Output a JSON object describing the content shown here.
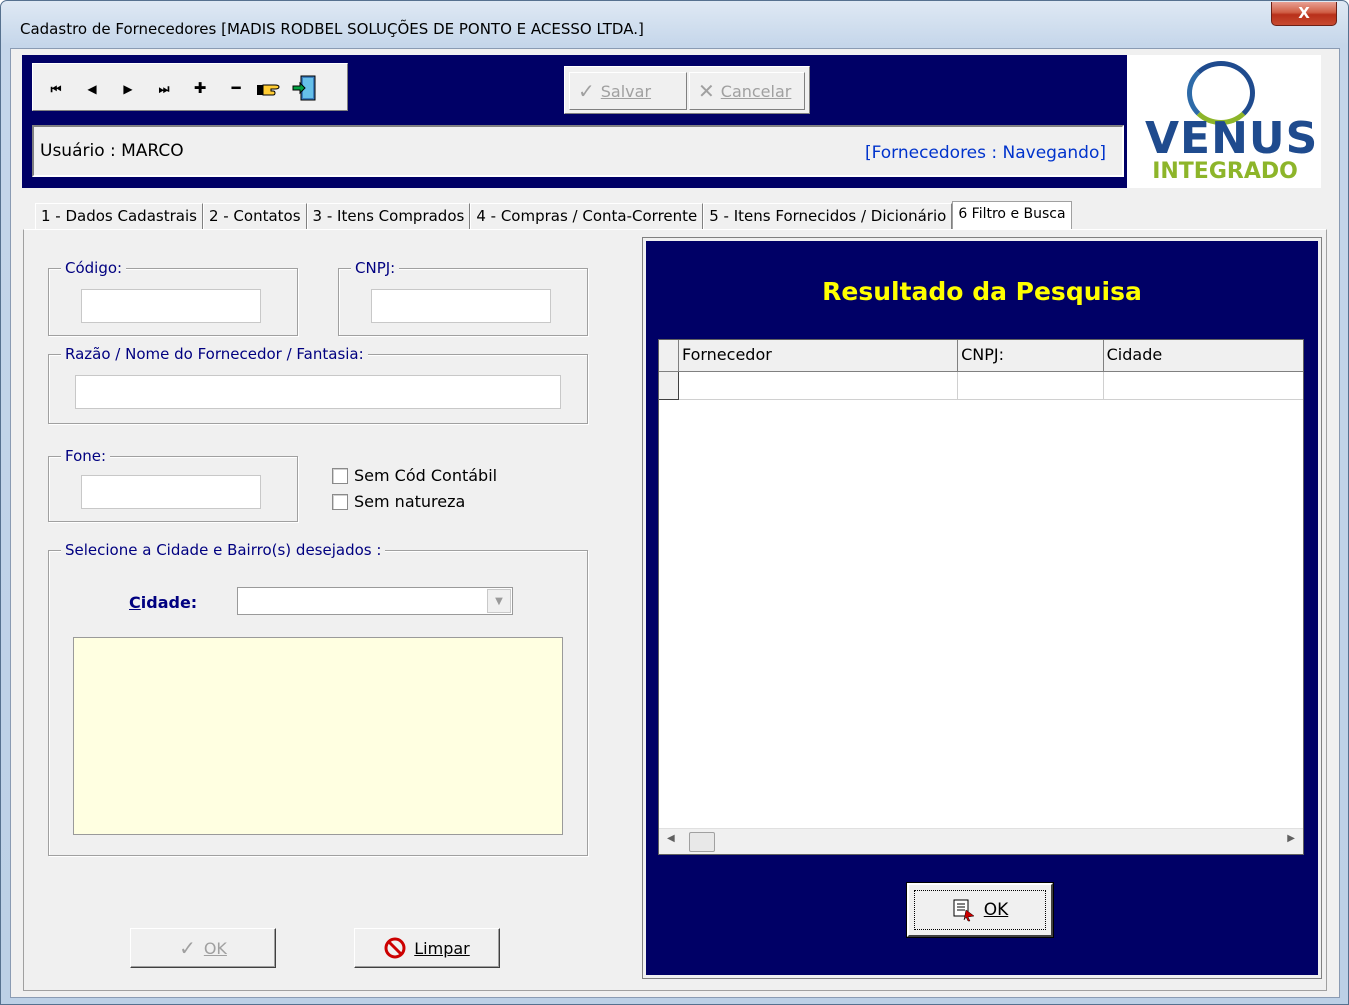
{
  "window": {
    "title": "Cadastro de Fornecedores [MADIS RODBEL SOLUÇÕES DE PONTO E ACESSO LTDA.]",
    "close_label": "X"
  },
  "toolbar": {
    "nav_first": "⏮",
    "nav_prev": "◀",
    "nav_next": "▶",
    "nav_last": "⏭",
    "nav_add": "✚",
    "nav_remove": "━",
    "save_label": "Salvar",
    "cancel_label": "Cancelar"
  },
  "userbar": {
    "user": "Usuário : MARCO",
    "status": "[Fornecedores : Navegando]"
  },
  "logo": {
    "name": "VENUS",
    "sub": "INTEGRADO"
  },
  "tabs": [
    {
      "label": "1 - Dados Cadastrais"
    },
    {
      "label": "2 -  Contatos"
    },
    {
      "label": "3 - Itens Comprados"
    },
    {
      "label": "4 - Compras / Conta-Corrente"
    },
    {
      "label": "5 - Itens Fornecidos / Dicionário"
    },
    {
      "label": "6 Filtro e Busca"
    }
  ],
  "filter": {
    "codigo_label": "Código:",
    "codigo_value": "",
    "cnpj_label": "CNPJ:",
    "cnpj_value": "",
    "razao_label": "Razão / Nome do Fornecedor / Fantasia:",
    "razao_value": "",
    "fone_label": "Fone:",
    "fone_value": "",
    "sem_cod_contabil": "Sem Cód Contábil",
    "sem_natureza": "Sem natureza",
    "cidade_group_label": "Selecione a Cidade e Bairro(s) desejados :",
    "cidade_label": "Cidade:",
    "cidade_value": "",
    "ok_label": "OK",
    "limpar_label": "Limpar"
  },
  "results": {
    "title": "Resultado da Pesquisa",
    "columns": [
      "Fornecedor",
      "CNPJ:",
      "Cidade"
    ],
    "ok_label": "OK"
  },
  "colors": {
    "navy": "#000066",
    "title_yellow": "#ffff00",
    "status_blue": "#0033cc",
    "logo_blue": "#1f4b8e",
    "logo_green": "#8db52a"
  }
}
